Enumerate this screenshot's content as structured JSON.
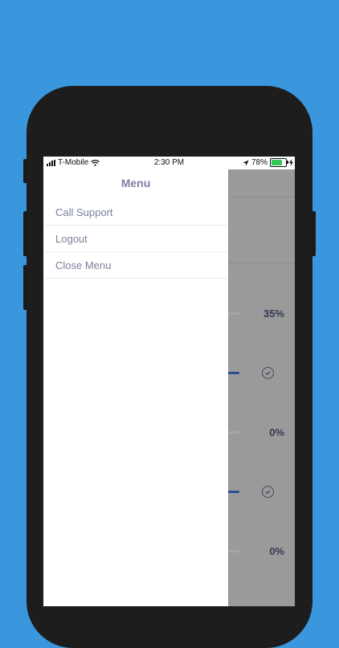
{
  "status_bar": {
    "carrier": "T-Mobile",
    "time": "2:30 PM",
    "battery": "78%",
    "battery_level": 0.78,
    "battery_color": "#34c759"
  },
  "menu": {
    "title": "Menu",
    "items": [
      {
        "label": "Call Support"
      },
      {
        "label": "Logout"
      },
      {
        "label": "Close Menu"
      }
    ]
  },
  "background_list": {
    "rows": [
      {
        "value": "35%",
        "progress": 0.35
      },
      {
        "status": "check-circle-icon",
        "progress": 1.0
      },
      {
        "value": "0%",
        "progress": 0.0
      },
      {
        "status": "check-circle-icon",
        "progress": 1.0
      },
      {
        "value": "0%",
        "progress": 0.0
      }
    ]
  },
  "colors": {
    "background": "#3a97dd",
    "menu_text": "#7b7f9e",
    "progress_fill": "#2b4c8d"
  }
}
